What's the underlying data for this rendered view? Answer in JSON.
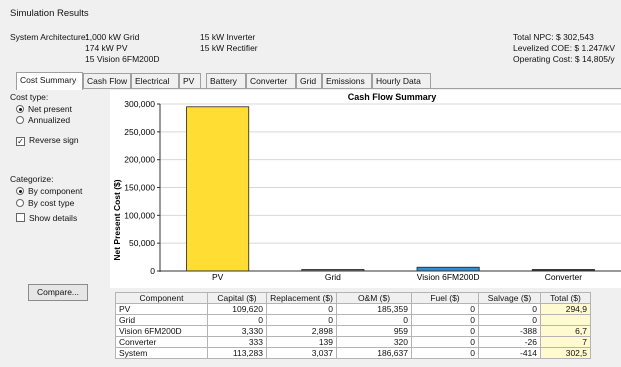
{
  "window_title": "Simulation Results",
  "architecture": {
    "label": "System Architecture:",
    "col1": [
      "1,000 kW Grid",
      "174 kW PV",
      "15 Vision 6FM200D"
    ],
    "col2": [
      "15 kW Inverter",
      "15 kW Rectifier"
    ]
  },
  "totals": {
    "npc": "Total NPC:  $ 302,543",
    "coe": "Levelized COE:  $ 1.247/kV",
    "opcost": "Operating Cost:  $ 14,805/y"
  },
  "tabs": [
    "Cost Summary",
    "Cash Flow",
    "Electrical",
    "PV",
    "Battery",
    "Converter",
    "Grid",
    "Emissions",
    "Hourly Data"
  ],
  "left_panel": {
    "cost_type_label": "Cost type:",
    "net_present": "Net present",
    "annualized": "Annualized",
    "reverse_sign": "Reverse sign",
    "categorize_label": "Categorize:",
    "by_component": "By component",
    "by_cost_type": "By cost type",
    "show_details": "Show details",
    "compare": "Compare..."
  },
  "chart_data": {
    "type": "bar",
    "title": "Cash Flow Summary",
    "ylabel": "Net Present Cost ($)",
    "xlabel": "",
    "categories": [
      "PV",
      "Grid",
      "Vision 6FM200D",
      "Converter"
    ],
    "values": [
      294979,
      0,
      6789,
      766
    ],
    "bar_colors": [
      "#ffdd33",
      "#777777",
      "#2f8fd6",
      "#333333"
    ],
    "ylim": [
      0,
      300000
    ],
    "yticks": [
      0,
      50000,
      100000,
      150000,
      200000,
      250000,
      300000
    ],
    "ytick_labels": [
      "0",
      "50,000",
      "100,000",
      "150,000",
      "200,000",
      "250,000",
      "300,000"
    ],
    "grid": true,
    "legend": "none"
  },
  "table": {
    "headers": [
      "Component",
      "Capital ($)",
      "Replacement ($)",
      "O&M ($)",
      "Fuel ($)",
      "Salvage ($)",
      "Total ($)"
    ],
    "rows": [
      [
        "PV",
        "109,620",
        "0",
        "185,359",
        "0",
        "0",
        "294,9"
      ],
      [
        "Grid",
        "0",
        "0",
        "0",
        "0",
        "0",
        ""
      ],
      [
        "Vision 6FM200D",
        "3,330",
        "2,898",
        "959",
        "0",
        "-388",
        "6,7"
      ],
      [
        "Converter",
        "333",
        "139",
        "320",
        "0",
        "-26",
        "7"
      ],
      [
        "System",
        "113,283",
        "3,037",
        "186,637",
        "0",
        "-414",
        "302,5"
      ]
    ]
  }
}
